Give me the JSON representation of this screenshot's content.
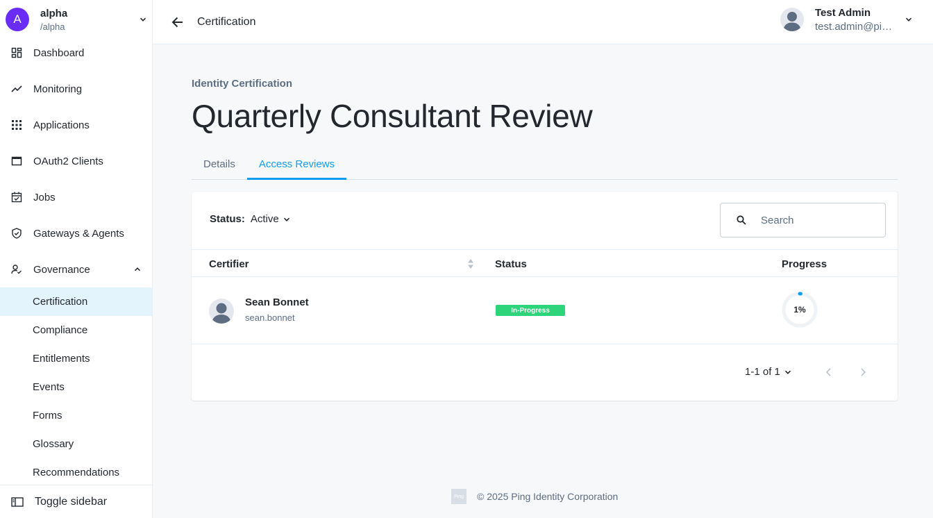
{
  "realm": {
    "initial": "A",
    "name": "alpha",
    "path": "/alpha"
  },
  "sidebar": {
    "items": [
      {
        "label": "Dashboard"
      },
      {
        "label": "Monitoring"
      },
      {
        "label": "Applications"
      },
      {
        "label": "OAuth2 Clients"
      },
      {
        "label": "Jobs"
      },
      {
        "label": "Gateways & Agents"
      },
      {
        "label": "Governance"
      }
    ],
    "governance_items": [
      {
        "label": "Certification"
      },
      {
        "label": "Compliance"
      },
      {
        "label": "Entitlements"
      },
      {
        "label": "Events"
      },
      {
        "label": "Forms"
      },
      {
        "label": "Glossary"
      },
      {
        "label": "Recommendations"
      }
    ],
    "toggle_label": "Toggle sidebar"
  },
  "header": {
    "title": "Certification"
  },
  "user": {
    "name": "Test Admin",
    "email": "test.admin@ping.com"
  },
  "page": {
    "eyebrow": "Identity Certification",
    "title": "Quarterly Consultant Review",
    "tabs": [
      {
        "label": "Details"
      },
      {
        "label": "Access Reviews"
      }
    ],
    "active_tab": "Access Reviews"
  },
  "filter": {
    "label": "Status:",
    "value": "Active"
  },
  "search": {
    "placeholder": "Search",
    "value": ""
  },
  "table": {
    "columns": [
      "Certifier",
      "Status",
      "Progress"
    ],
    "rows": [
      {
        "name": "Sean Bonnet",
        "username": "sean.bonnet",
        "status": "In-Progress",
        "progress_label": "1%",
        "progress": 0.01
      }
    ]
  },
  "pagination": {
    "label": "1-1 of 1"
  },
  "footer": {
    "logo": "Ping",
    "text": "© 2025  Ping Identity Corporation"
  },
  "colors": {
    "accent": "#109cf1",
    "realm_avatar": "#6a2cf5",
    "status_badge": "#2ed47a",
    "active_nav_bg": "#e4f4fd"
  }
}
